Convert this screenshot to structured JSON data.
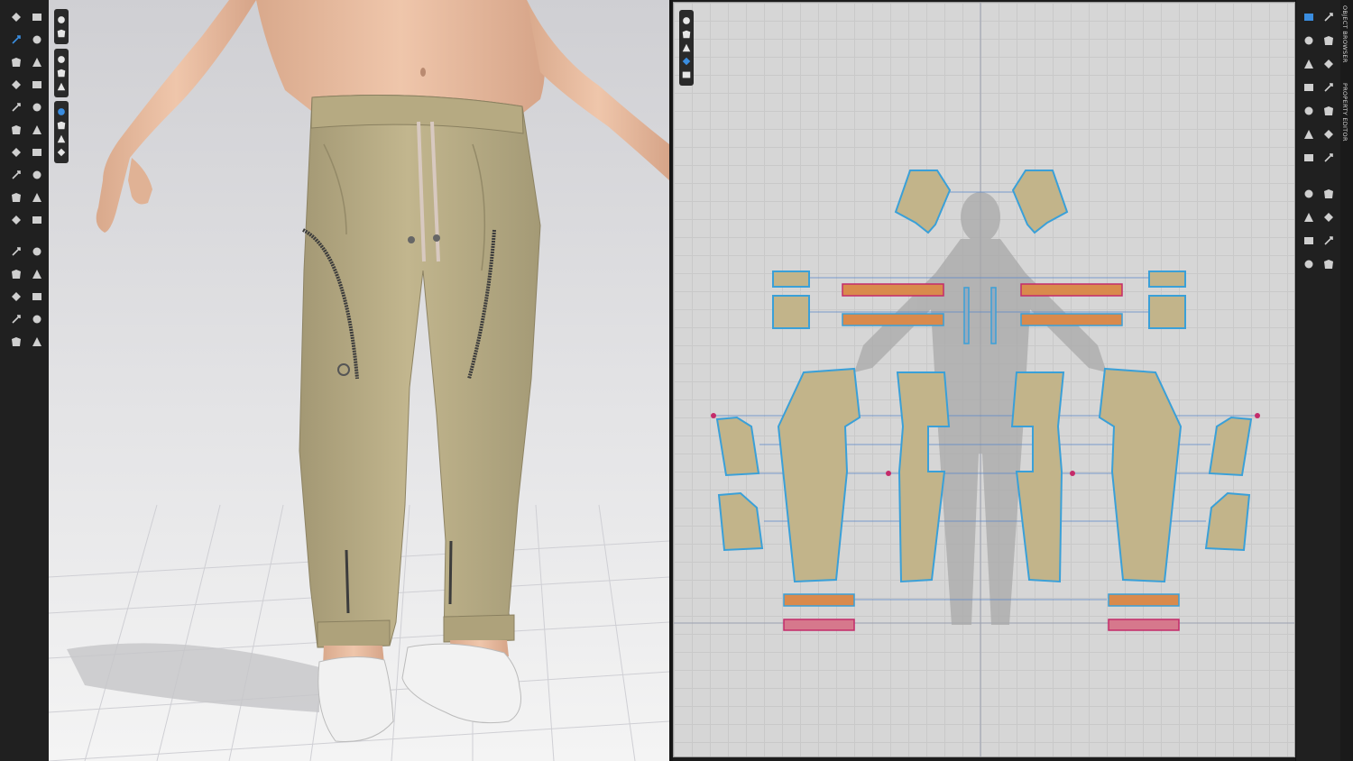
{
  "app": {
    "accent_color": "#3a8de0",
    "garment_color": "#c2b48a"
  },
  "side_panels": {
    "object_browser": "OBJECT BROWSER",
    "property_editor": "PROPERTY EDITOR"
  },
  "left_toolbar": {
    "tools": [
      "move-icon",
      "avatar-pose-icon",
      "transform-icon",
      "pin-icon",
      "fold-icon",
      "pin-box-icon",
      "select-mesh-icon",
      "gizmo-icon",
      "measure-icon",
      "tape-icon",
      "avatar-icon",
      "garment-icon",
      "pencil-icon",
      "seam-icon",
      "sewing-icon",
      "elastic-icon",
      "tuck-icon",
      "edit-sewing-icon",
      "fabric-icon",
      "button-icon",
      "buttonhole-icon",
      "zipper-icon",
      "topstitch-icon",
      "puckering-icon",
      "trim-icon",
      "sticker-icon",
      "brush-icon",
      "ruler-icon",
      "tag-icon",
      "eyedropper-icon"
    ]
  },
  "viewport_3d": {
    "toolbar_top": [
      "camera-icon",
      "light-icon"
    ],
    "toolbar_mid": [
      "shirt-icon",
      "hanger-icon",
      "avatar-toggle-icon"
    ],
    "toolbar_low": [
      "texture-icon",
      "wireframe-icon",
      "sun-icon",
      "sphere-icon"
    ]
  },
  "viewport_2d": {
    "toolbar": [
      "arrange-icon",
      "shirt-icon",
      "info-icon",
      "magnet-icon",
      "layer-icon"
    ]
  },
  "right_toolbar": {
    "tools": [
      "select-edit-icon",
      "transform-pattern-icon",
      "edit-point-icon",
      "curve-point-icon",
      "polygon-icon",
      "rectangle-icon",
      "circle-icon",
      "internal-polygon-icon",
      "dart-icon",
      "trace-icon",
      "seam-allowance-icon",
      "pleat-icon",
      "notch-icon",
      "symmetry-icon",
      "segment-sewing-icon",
      "free-sewing-icon",
      "text-icon",
      "annotation-icon",
      "grading-icon",
      "texture-edit-icon",
      "pattern-check-icon",
      "sewing-check-icon"
    ]
  }
}
